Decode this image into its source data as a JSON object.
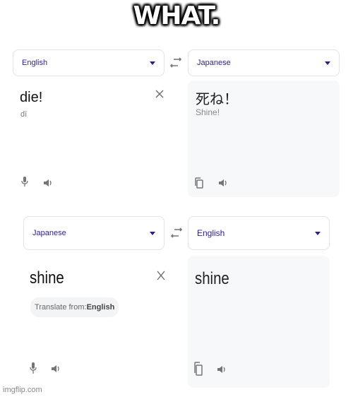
{
  "caption": "WHAT.",
  "panel_top": {
    "source_lang": "English",
    "target_lang": "Japanese",
    "input_text": "die!",
    "input_transliteration": "dī",
    "output_text": "死ね！",
    "output_transliteration": "Shine!"
  },
  "panel_bottom": {
    "source_lang": "Japanese",
    "target_lang": "English",
    "input_text": "shine",
    "translate_from_prefix": "Translate from:",
    "translate_from_lang": "English",
    "output_text": "shine"
  },
  "icons": {
    "clear": "close-icon",
    "swap": "swap-icon",
    "mic": "microphone-icon",
    "speaker": "speaker-icon",
    "copy": "copy-icon"
  },
  "watermark": "imgflip.com",
  "colors": {
    "lang_label": "#2a1e8c",
    "output_bg": "#f7f8fa",
    "icon_gray": "#757575"
  }
}
